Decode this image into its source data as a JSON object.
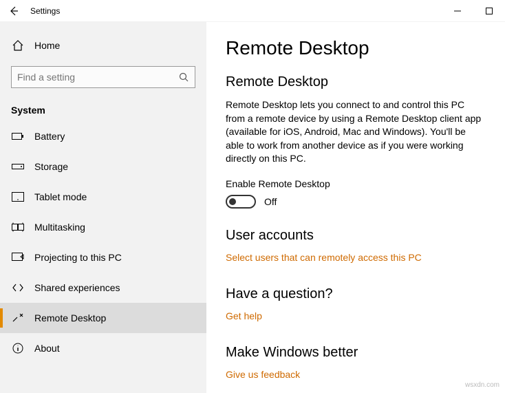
{
  "window": {
    "app_title": "Settings"
  },
  "sidebar": {
    "home_label": "Home",
    "search_placeholder": "Find a setting",
    "category": "System",
    "items": [
      {
        "label": "Battery"
      },
      {
        "label": "Storage"
      },
      {
        "label": "Tablet mode"
      },
      {
        "label": "Multitasking"
      },
      {
        "label": "Projecting to this PC"
      },
      {
        "label": "Shared experiences"
      },
      {
        "label": "Remote Desktop"
      },
      {
        "label": "About"
      }
    ]
  },
  "main": {
    "page_title": "Remote Desktop",
    "sections": {
      "rd": {
        "title": "Remote Desktop",
        "description": "Remote Desktop lets you connect to and control this PC from a remote device by using a Remote Desktop client app (available for iOS, Android, Mac and Windows). You'll be able to work from another device as if you were working directly on this PC.",
        "toggle_label": "Enable Remote Desktop",
        "toggle_state": "Off"
      },
      "users": {
        "title": "User accounts",
        "link": "Select users that can remotely access this PC"
      },
      "question": {
        "title": "Have a question?",
        "link": "Get help"
      },
      "feedback": {
        "title": "Make Windows better",
        "link": "Give us feedback"
      }
    }
  },
  "watermark": "wsxdn.com"
}
